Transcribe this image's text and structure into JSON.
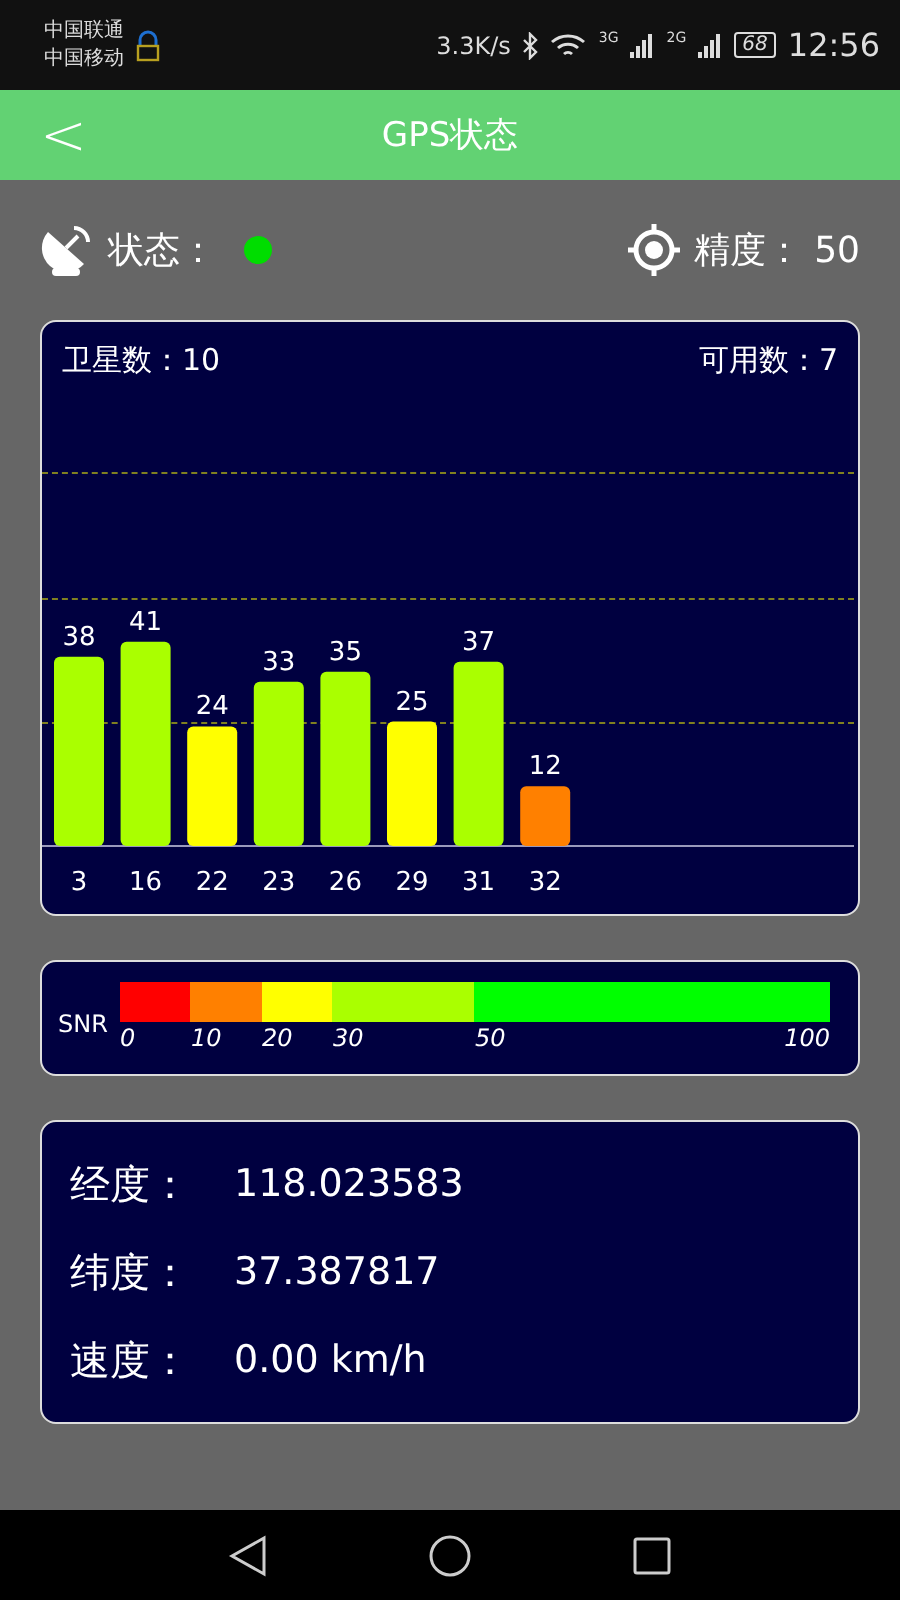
{
  "status_bar": {
    "carriers": [
      "中国联通",
      "中国移动"
    ],
    "speed": "3.3K/s",
    "networks": [
      "3G",
      "2G"
    ],
    "battery": "68",
    "time": "12:56"
  },
  "header": {
    "back": "<",
    "title": "GPS状态"
  },
  "summary": {
    "status_label": "状态：",
    "status_fixed": true,
    "accuracy_label": "精度：",
    "accuracy": "50"
  },
  "satellites": {
    "total_label": "卫星数：",
    "total": "10",
    "usable_label": "可用数：",
    "usable": "7",
    "chart_data": {
      "type": "bar",
      "categories": [
        "3",
        "16",
        "22",
        "23",
        "26",
        "29",
        "31",
        "32"
      ],
      "values": [
        38,
        41,
        24,
        33,
        35,
        25,
        37,
        12
      ],
      "data_labels": true
    }
  },
  "snr_scale": {
    "label": "SNR",
    "bands": [
      {
        "from": "0",
        "color": "#ff0000"
      },
      {
        "from": "10",
        "color": "#ff8000"
      },
      {
        "from": "20",
        "color": "#ffff00"
      },
      {
        "from": "30",
        "color": "#aaff00"
      },
      {
        "from": "50",
        "color": "#00ff00"
      }
    ],
    "end": "100"
  },
  "info": [
    {
      "label": "经度：",
      "value": "118.023583"
    },
    {
      "label": "纬度：",
      "value": "37.387817"
    },
    {
      "label": "速度：",
      "value": "0.00 km/h"
    }
  ]
}
